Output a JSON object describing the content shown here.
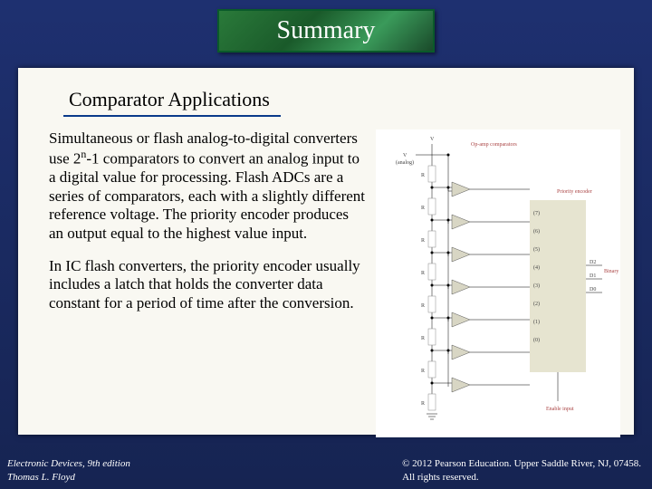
{
  "banner": {
    "title": "Summary"
  },
  "section": {
    "title": "Comparator Applications"
  },
  "paragraphs": {
    "p1_a": "Simultaneous or flash analog-to-digital converters use 2",
    "p1_exp": "n",
    "p1_b": "-1 comparators to convert an analog input to a digital value for processing. Flash ADCs are a series of comparators, each with a slightly different reference voltage. The priority encoder produces an output equal to the highest value input.",
    "p2": "In IC flash converters, the priority encoder usually includes a latch that holds the converter data constant for a period of time after the conversion."
  },
  "diagram": {
    "vref_top": "V",
    "vin_label": "V",
    "analog_label": "(analog)",
    "opamp_label": "Op-amp comparators",
    "encoder_label": "Priority encoder",
    "r_label": "R",
    "inputs": [
      "(7)",
      "(6)",
      "(5)",
      "(4)",
      "(3)",
      "(2)",
      "(1)",
      "(0)"
    ],
    "outputs": [
      "D2",
      "D1",
      "D0"
    ],
    "binary_label": "Binary output",
    "enable_label": "Enable input"
  },
  "footer": {
    "left_line1": "Electronic Devices, 9th edition",
    "left_line2": "Thomas L. Floyd",
    "right_line1": "© 2012 Pearson Education. Upper Saddle River, NJ, 07458.",
    "right_line2": "All rights reserved."
  }
}
